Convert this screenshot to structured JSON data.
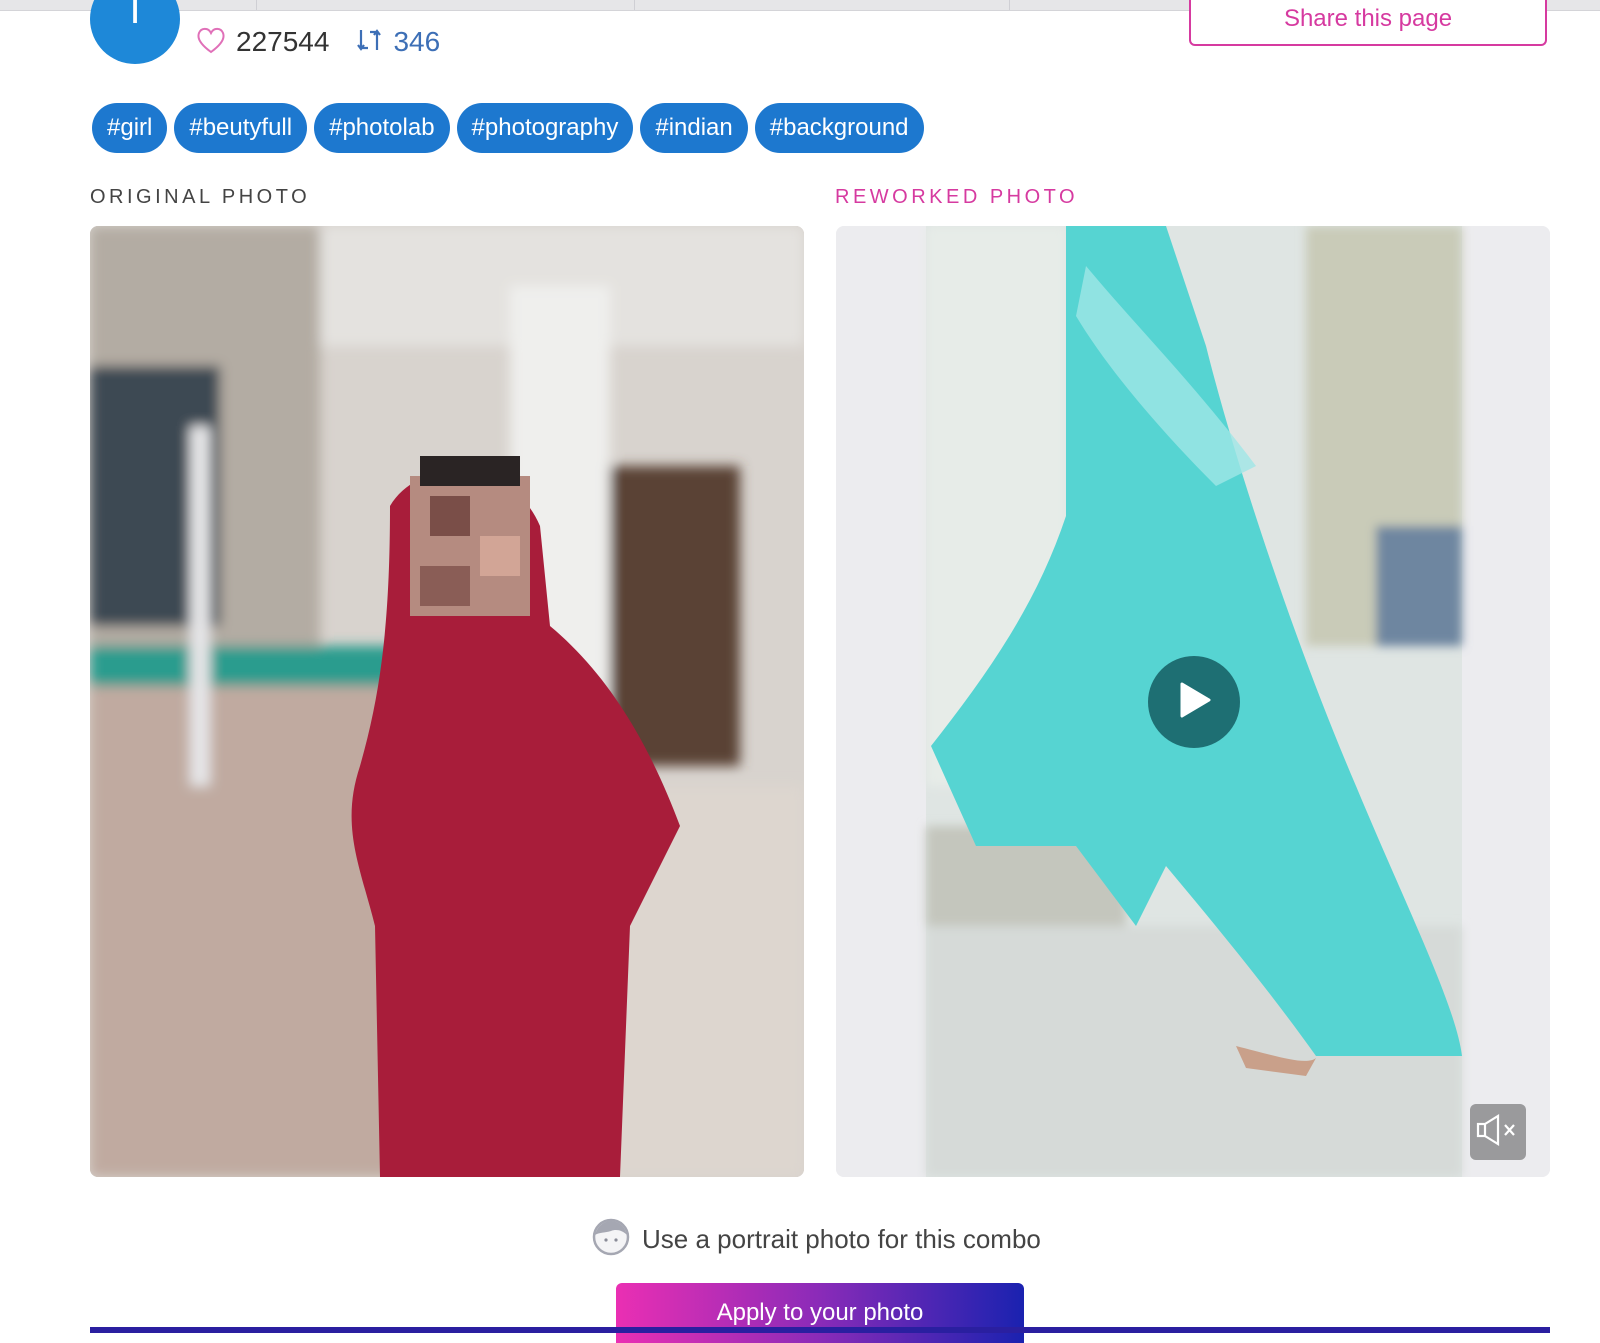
{
  "header": {
    "avatar_letter": "I",
    "likes_count": "227544",
    "remix_count": "346",
    "share_label": "Share this page"
  },
  "tags": [
    "#girl",
    "#beutyfull",
    "#photolab",
    "#photography",
    "#indian",
    "#background"
  ],
  "sections": {
    "original_label": "ORIGINAL PHOTO",
    "reworked_label": "REWORKED PHOTO"
  },
  "icons": {
    "likes": "heart-icon",
    "remix": "repost-icon",
    "play": "play-icon",
    "mute": "speaker-muted-icon",
    "hint": "face-icon"
  },
  "hint": {
    "text": "Use a portrait photo for this combo"
  },
  "actions": {
    "apply_label": "Apply to your photo"
  },
  "colors": {
    "accent_pink": "#d63aa0",
    "tag_blue": "#1d78cf",
    "avatar_blue": "#1e88d8",
    "remix_blue": "#3d6fb6",
    "apply_gradient_start": "#ea2fb3",
    "apply_gradient_end": "#1a22b0"
  }
}
